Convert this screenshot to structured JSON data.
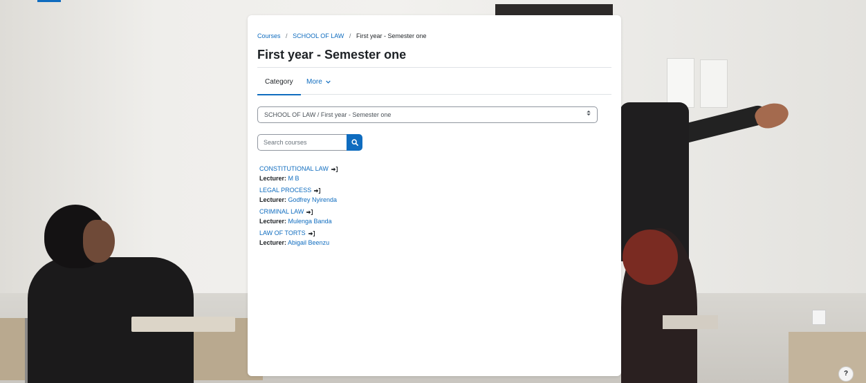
{
  "breadcrumb": {
    "items": [
      "Courses",
      "SCHOOL OF LAW",
      "First year - Semester one"
    ],
    "separator": "/"
  },
  "page": {
    "title": "First year - Semester one"
  },
  "tabs": [
    {
      "label": "Category",
      "active": true
    },
    {
      "label": "More",
      "icon": "chevron-down-icon"
    }
  ],
  "category_select": {
    "selected": "SCHOOL OF LAW / First year - Semester one"
  },
  "search": {
    "placeholder": "Search courses",
    "icon": "search-icon"
  },
  "courses": [
    {
      "name": "CONSTITUTIONAL LAW",
      "lecturer_label": "Lecturer:",
      "lecturer": "M B"
    },
    {
      "name": "LEGAL PROCESS",
      "lecturer_label": "Lecturer:",
      "lecturer": "Godfrey Nyirenda"
    },
    {
      "name": "CRIMINAL LAW",
      "lecturer_label": "Lecturer:",
      "lecturer": "Mulenga Banda"
    },
    {
      "name": "LAW OF TORTS",
      "lecturer_label": "Lecturer:",
      "lecturer": "Abigail Beenzu"
    }
  ],
  "help": {
    "label": "?"
  },
  "colors": {
    "accent": "#0f6cbf",
    "text": "#1d2125",
    "border": "#dee2e6"
  }
}
